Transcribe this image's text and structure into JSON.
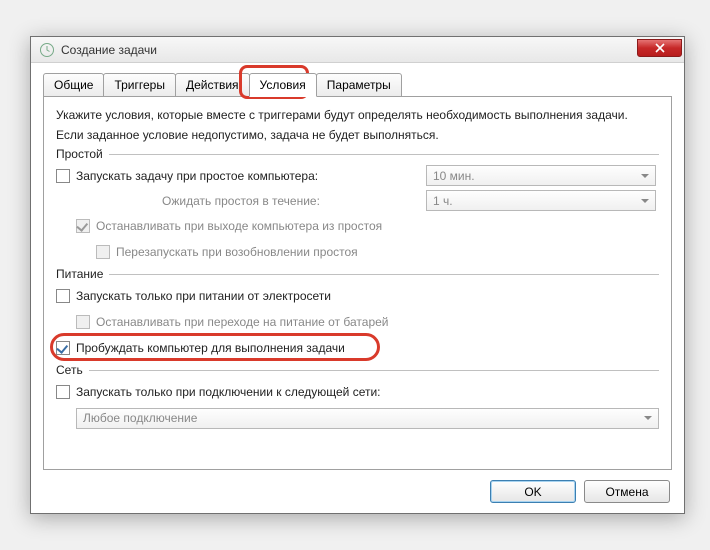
{
  "window": {
    "title": "Создание задачи"
  },
  "tabs": {
    "general": "Общие",
    "triggers": "Триггеры",
    "actions": "Действия",
    "conditions": "Условия",
    "settings": "Параметры"
  },
  "instructions": {
    "line1": "Укажите условия, которые вместе с триггерами будут определять необходимость выполнения задачи.",
    "line2": "Если заданное условие недопустимо, задача не будет выполняться."
  },
  "groups": {
    "idle": "Простой",
    "power": "Питание",
    "network": "Сеть"
  },
  "idle": {
    "start_label": "Запускать задачу при простое компьютера:",
    "wait_label": "Ожидать простоя в течение:",
    "stop_label": "Останавливать при выходе компьютера из простоя",
    "restart_label": "Перезапускать при возобновлении простоя",
    "duration_value": "10 мин.",
    "wait_value": "1 ч."
  },
  "power": {
    "ac_only_label": "Запускать только при питании от электросети",
    "stop_battery_label": "Останавливать при переходе на питание от батарей",
    "wake_label": "Пробуждать компьютер для выполнения задачи"
  },
  "network": {
    "only_network_label": "Запускать только при подключении к следующей сети:",
    "any_connection": "Любое подключение"
  },
  "buttons": {
    "ok": "OK",
    "cancel": "Отмена"
  }
}
